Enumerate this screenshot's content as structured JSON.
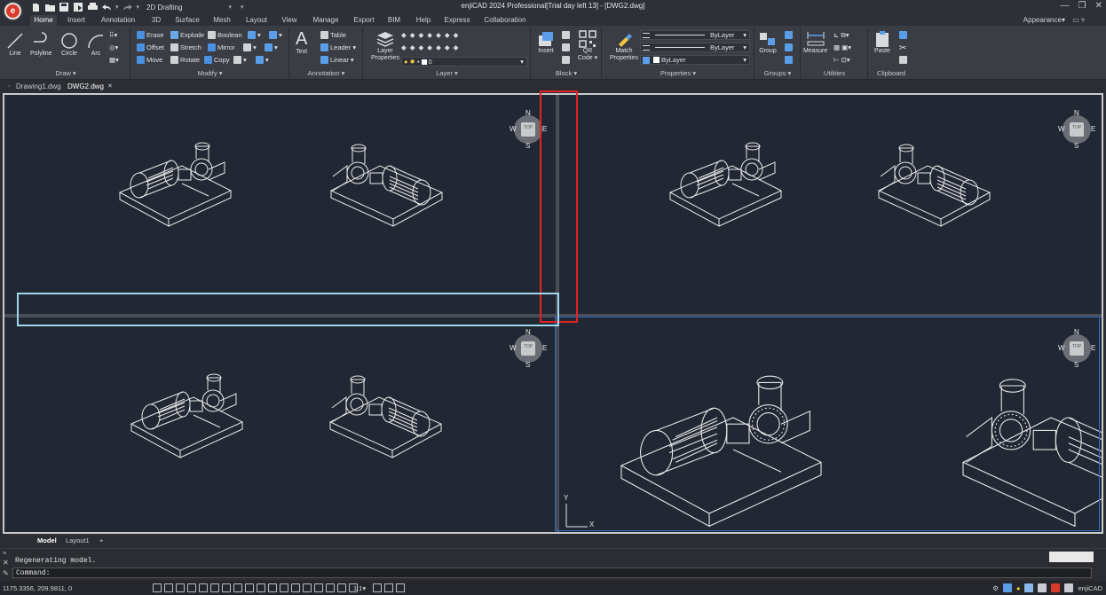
{
  "app": {
    "title": "enjiCAD 2024 Professional[Trial day left 13] - [DWG2.dwg]",
    "logo": "e",
    "workspace": "2D Drafting",
    "window_controls": [
      "—",
      "❐",
      "✕"
    ]
  },
  "ribbon_tabs": [
    "Home",
    "Insert",
    "Annotation",
    "3D",
    "Surface",
    "Mesh",
    "Layout",
    "View",
    "Manage",
    "Export",
    "BIM",
    "Help",
    "Express",
    "Collaboration"
  ],
  "active_tab": "Home",
  "appearance_label": "Appearance▾",
  "panels": {
    "draw": {
      "title": "Draw ▾",
      "tools": [
        "Line",
        "Polyline",
        "Circle",
        "Arc"
      ]
    },
    "modify": {
      "title": "Modify ▾",
      "tools": [
        "Erase",
        "Explode",
        "Boolean",
        "Offset",
        "Stretch",
        "Mirror",
        "Move",
        "Rotate",
        "Copy"
      ]
    },
    "annotation": {
      "title": "Annotation ▾",
      "text": "Text",
      "table": "Table",
      "leader": "Leader ▾",
      "linear": "Linear ▾"
    },
    "layer": {
      "title": "Layer ▾",
      "properties": "Layer Properties",
      "current": "0"
    },
    "block": {
      "title": "Block ▾",
      "insert": "Insert",
      "qr": "QR Code ▾"
    },
    "properties": {
      "title": "Properties ▾",
      "match": "Match Properties",
      "color": "ByLayer",
      "linetype": "ByLayer",
      "lineweight": "ByLayer"
    },
    "groups": {
      "title": "Groups ▾",
      "group": "Group"
    },
    "utilities": {
      "title": "Utilities",
      "measure": "Measure"
    },
    "clipboard": {
      "title": "Clipboard",
      "paste": "Paste"
    }
  },
  "doc_tabs": [
    "Drawing1.dwg",
    "DWG2.dwg"
  ],
  "active_doc": "DWG2.dwg",
  "viewcube": {
    "top": "TOP",
    "n": "N",
    "s": "S",
    "e": "E",
    "w": "W"
  },
  "ucs": {
    "x": "X",
    "y": "Y"
  },
  "layout_tabs": [
    "Model",
    "Layout1",
    "+"
  ],
  "command": {
    "log": "Regenerating model.",
    "prompt": "Command:"
  },
  "status": {
    "coords": "1175.3356, 209.9811, 0",
    "scale": "1:1▾",
    "product": "enjiCAD"
  },
  "colors": {
    "canvas": "#222833",
    "accent_red": "#e02424",
    "accent_blue": "#9ed8ec",
    "active_viewport": "#2f6cc2"
  }
}
